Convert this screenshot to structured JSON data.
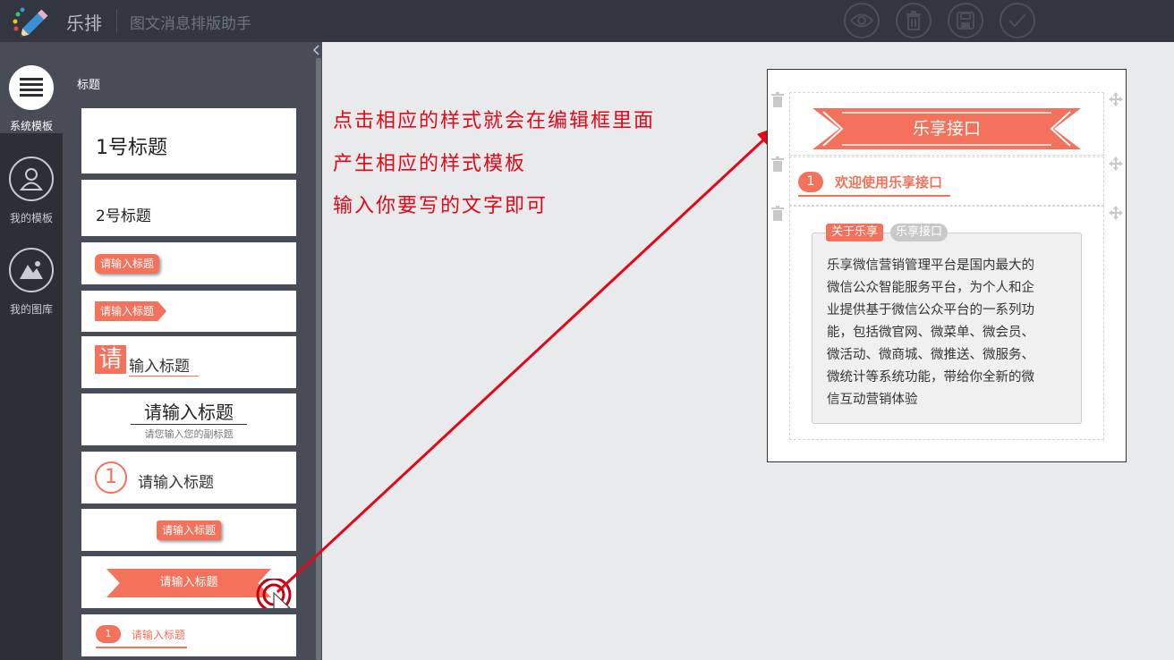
{
  "app": {
    "brand": "乐排",
    "subtitle": "图文消息排版助手"
  },
  "toolbar": [
    {
      "icon": "eye-icon"
    },
    {
      "icon": "trash-icon"
    },
    {
      "icon": "save-icon"
    },
    {
      "icon": "check-icon"
    }
  ],
  "sidebar": {
    "items": [
      {
        "label": "系统模板",
        "icon": "list-icon",
        "active": true
      },
      {
        "label": "我的模板",
        "icon": "user-icon"
      },
      {
        "label": "我的图库",
        "icon": "image-icon"
      }
    ]
  },
  "panel": {
    "title": "标题",
    "templates": [
      {
        "text": "1号标题"
      },
      {
        "text": "2号标题"
      },
      {
        "text": "请输入标题"
      },
      {
        "text": "请输入标题"
      },
      {
        "first": "请",
        "rest": "输入标题"
      },
      {
        "text": "请输入标题",
        "sub": "请您输入您的副标题"
      },
      {
        "num": "1",
        "text": "请输入标题"
      },
      {
        "text": "请输入标题"
      },
      {
        "text": "请输入标题"
      },
      {
        "num": "1",
        "text": "请输入标题"
      }
    ]
  },
  "annotation": {
    "lines": [
      "点击相应的样式就会在编辑框里面",
      "产生相应的样式模板",
      "输入你要写的文字即可"
    ],
    "color": "#e3071a"
  },
  "editor": {
    "ribbon_title": "乐享接口",
    "numbered_title": {
      "num": "1",
      "text": "欢迎使用乐享接口"
    },
    "tags": [
      "关于乐享",
      "乐享接口"
    ],
    "body_lines": [
      "乐享微信营销管理平台是国内最大的",
      "微信公众智能服务平台，为个人和企",
      "业提供基于微信公众平台的一系列功",
      "能，包括微官网、微菜单、微会员、",
      "微活动、微商城、微推送、微服务、",
      "微统计等系统功能，带给你全新的微",
      "信互动营销体验"
    ]
  },
  "colors": {
    "accent": "#f4725b",
    "topbar": "#313640",
    "sidebar": "#2b3037",
    "panel": "#474c57"
  }
}
